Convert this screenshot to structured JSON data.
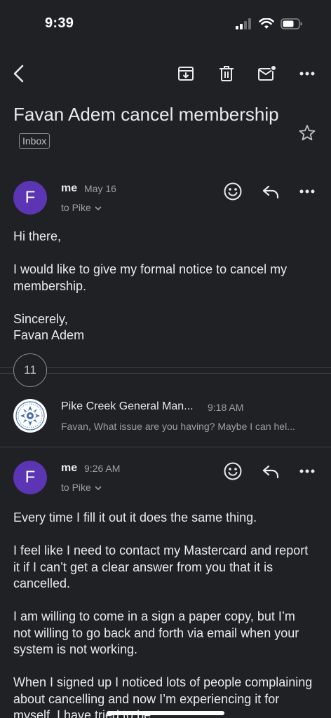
{
  "status_bar": {
    "time": "9:39"
  },
  "toolbar": {
    "back_icon": "chevron-left-icon",
    "archive_icon": "archive-icon",
    "delete_icon": "trash-icon",
    "mark_unread_icon": "mail-unread-icon",
    "more_icon": "more-horizontal-icon"
  },
  "thread": {
    "subject": "Favan Adem cancel membership",
    "label": "Inbox",
    "collapsed_count": "11"
  },
  "messages": [
    {
      "avatar_letter": "F",
      "sender": "me",
      "date": "May 16",
      "to": "to Pike",
      "paragraphs": [
        "Hi there,",
        "I would like to give my formal notice to cancel my membership.",
        "Sincerely,\nFavan Adem"
      ]
    },
    {
      "sender": "Pike Creek General Man...",
      "time": "9:18 AM",
      "snippet": "Favan, What issue are you having? Maybe I can hel..."
    },
    {
      "avatar_letter": "F",
      "sender": "me",
      "date": "9:26 AM",
      "to": "to Pike",
      "paragraphs": [
        "Every time I fill it out it does the same thing.",
        "I feel like I need to contact my Mastercard and report it if I can’t get a clear answer from you that it is cancelled.",
        "I am willing to come in a sign a paper copy, but I’m not willing to go back and forth via email when your system is not working.",
        "When I signed up I noticed lots of people complaining about cancelling and now I’m experiencing it for myself. I have tried to be"
      ]
    }
  ],
  "colors": {
    "background": "#202124",
    "avatar": "#5c35b5",
    "text": "#e8eaed",
    "muted": "#9aa0a6"
  }
}
